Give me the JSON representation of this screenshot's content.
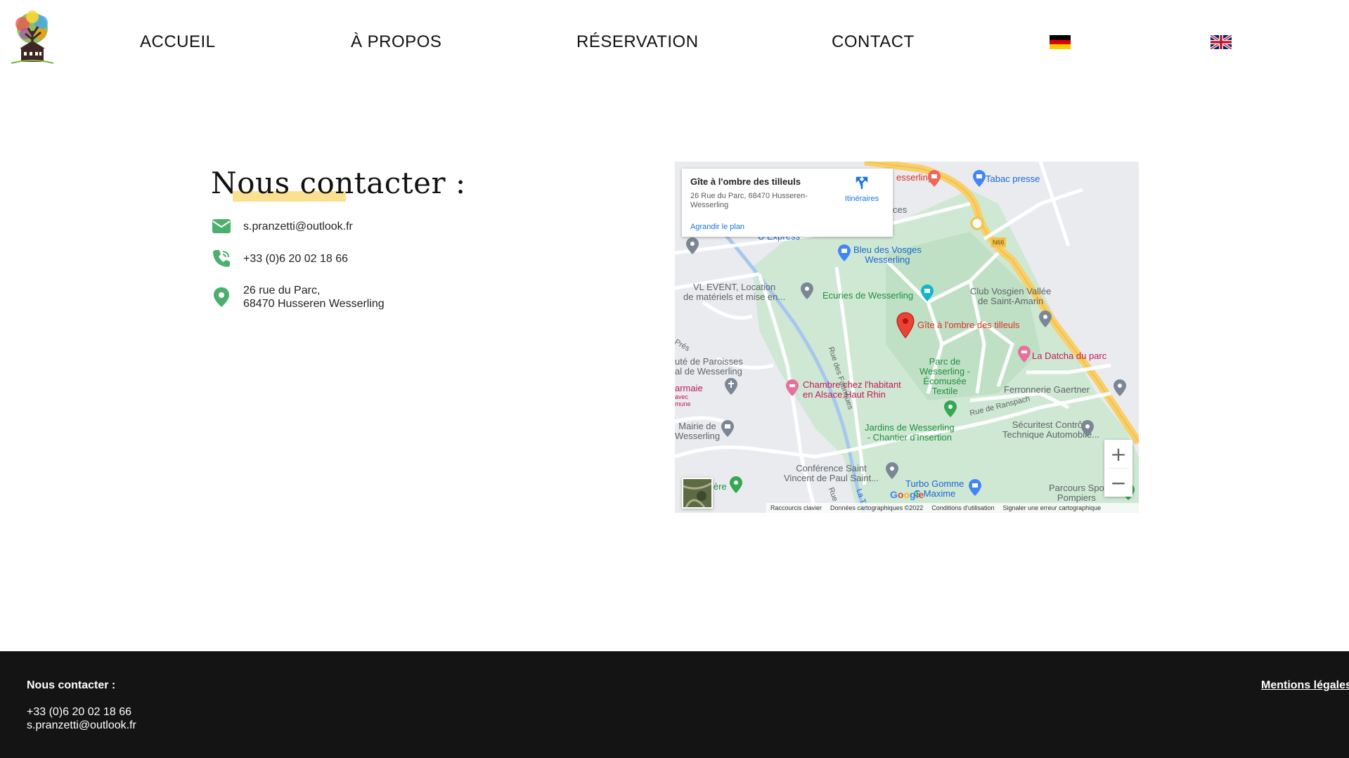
{
  "header": {
    "nav": [
      {
        "label": "ACCUEIL"
      },
      {
        "label": "À PROPOS"
      },
      {
        "label": "RÉSERVATION"
      },
      {
        "label": "CONTACT"
      }
    ],
    "languages": [
      {
        "name": "german-flag-icon"
      },
      {
        "name": "uk-flag-icon"
      }
    ]
  },
  "contact": {
    "title": "Nous contacter :",
    "email": "s.pranzetti@outlook.fr",
    "phone": "+33 (0)6 20 02 18 66",
    "address_line1": "26 rue du Parc,",
    "address_line2": "68470 Husseren Wesserling",
    "accent_color": "#4caf6e",
    "highlight_color": "#fbe08f"
  },
  "map": {
    "place_name": "Gîte à l'ombre des tilleuls",
    "place_address": "26 Rue du Parc, 68470 Husseren-Wesserling",
    "directions_label": "Itinéraires",
    "enlarge_label": "Agrandir le plan",
    "zoom_in": "+",
    "zoom_out": "−",
    "google": "Google",
    "footer": {
      "shortcuts": "Raccourcis clavier",
      "data": "Données cartographiques ©2022",
      "terms": "Conditions d'utilisation",
      "report": "Signaler une erreur cartographique"
    },
    "labels": {
      "gite": "Gîte à l'ombre des tilleuls",
      "tabac": "Tabac presse",
      "wesserling_top": "esserling",
      "services": "ces",
      "express": "U Express",
      "bleu_vosges_1": "Bleu des Vosges",
      "bleu_vosges_2": "Wesserling",
      "vl_event_1": "VL EVENT, Location",
      "vl_event_2": "de matériels et mise en...",
      "ecuries": "Ecuries de Wesserling",
      "club_1": "Club Vosgien Vallée",
      "club_2": "de Saint-Amarin",
      "rue_fabriques": "Rue des Fabriques",
      "n66": "N66",
      "datcha": "La Datcha du parc",
      "pres": "Prés",
      "paroisses_1": "uté de Paroisses",
      "paroisses_2": "al de Wesserling",
      "parc_1": "Parc de",
      "parc_2": "Wesserling -",
      "parc_3": "Écomusée",
      "parc_4": "Textile",
      "chambre_1": "Chambre chez l'habitant",
      "chambre_2": "en Alsace Haut Rhin",
      "armaie": "armaie",
      "avec": "avec",
      "mune": "mune",
      "ferronnerie": "Ferronnerie Gaertner",
      "ranspach": "Rue de Ranspach",
      "jardins_1": "Jardins de Wesserling",
      "jardins_2": "- Chantier d'Insertion",
      "mairie_1": "Mairie de",
      "mairie_2": "Wesserling",
      "securitest_1": "Sécuritest Contrôle",
      "securitest_2": "Technique Automobile...",
      "conference_1": "Conférence Saint",
      "conference_2": "Vincent de Paul Saint...",
      "iere": "ière",
      "turbo_1": "Turbo Gomme",
      "turbo_2": "G Maxime",
      "parcours_1": "Parcours Spo",
      "parcours_2": "Pompiers",
      "rue": "Rue",
      "la_t": "La T"
    }
  },
  "footer": {
    "title": "Nous contacter :",
    "phone": "+33 (0)6 20 02 18 66",
    "email": "s.pranzetti@outlook.fr",
    "legal": "Mentions légales"
  }
}
